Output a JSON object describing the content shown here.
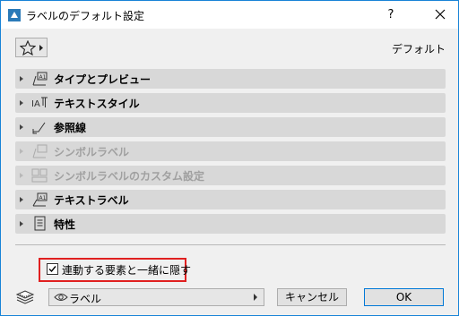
{
  "window": {
    "title": "ラベルのデフォルト設定",
    "help_label": "?"
  },
  "header": {
    "favorites_icon": "star-icon",
    "default_label": "デフォルト"
  },
  "panels": [
    {
      "label": "タイプとプレビュー",
      "icon": "label-type-icon",
      "enabled": true
    },
    {
      "label": "テキストスタイル",
      "icon": "text-style-icon",
      "enabled": true
    },
    {
      "label": "参照線",
      "icon": "pointer-line-icon",
      "enabled": true
    },
    {
      "label": "シンボルラベル",
      "icon": "symbol-label-icon",
      "enabled": false
    },
    {
      "label": "シンボルラベルのカスタム設定",
      "icon": "symbol-custom-icon",
      "enabled": false
    },
    {
      "label": "テキストラベル",
      "icon": "text-label-icon",
      "enabled": true
    },
    {
      "label": "特性",
      "icon": "properties-icon",
      "enabled": true
    }
  ],
  "footer": {
    "checkbox_label": "連動する要素と一緒に隠す",
    "checkbox_checked": true,
    "layer_value": "ラベル",
    "cancel_label": "キャンセル",
    "ok_label": "OK"
  },
  "colors": {
    "highlight": "#e02020",
    "panel_bg": "#d8d8d8",
    "window_border": "#1883d7"
  }
}
